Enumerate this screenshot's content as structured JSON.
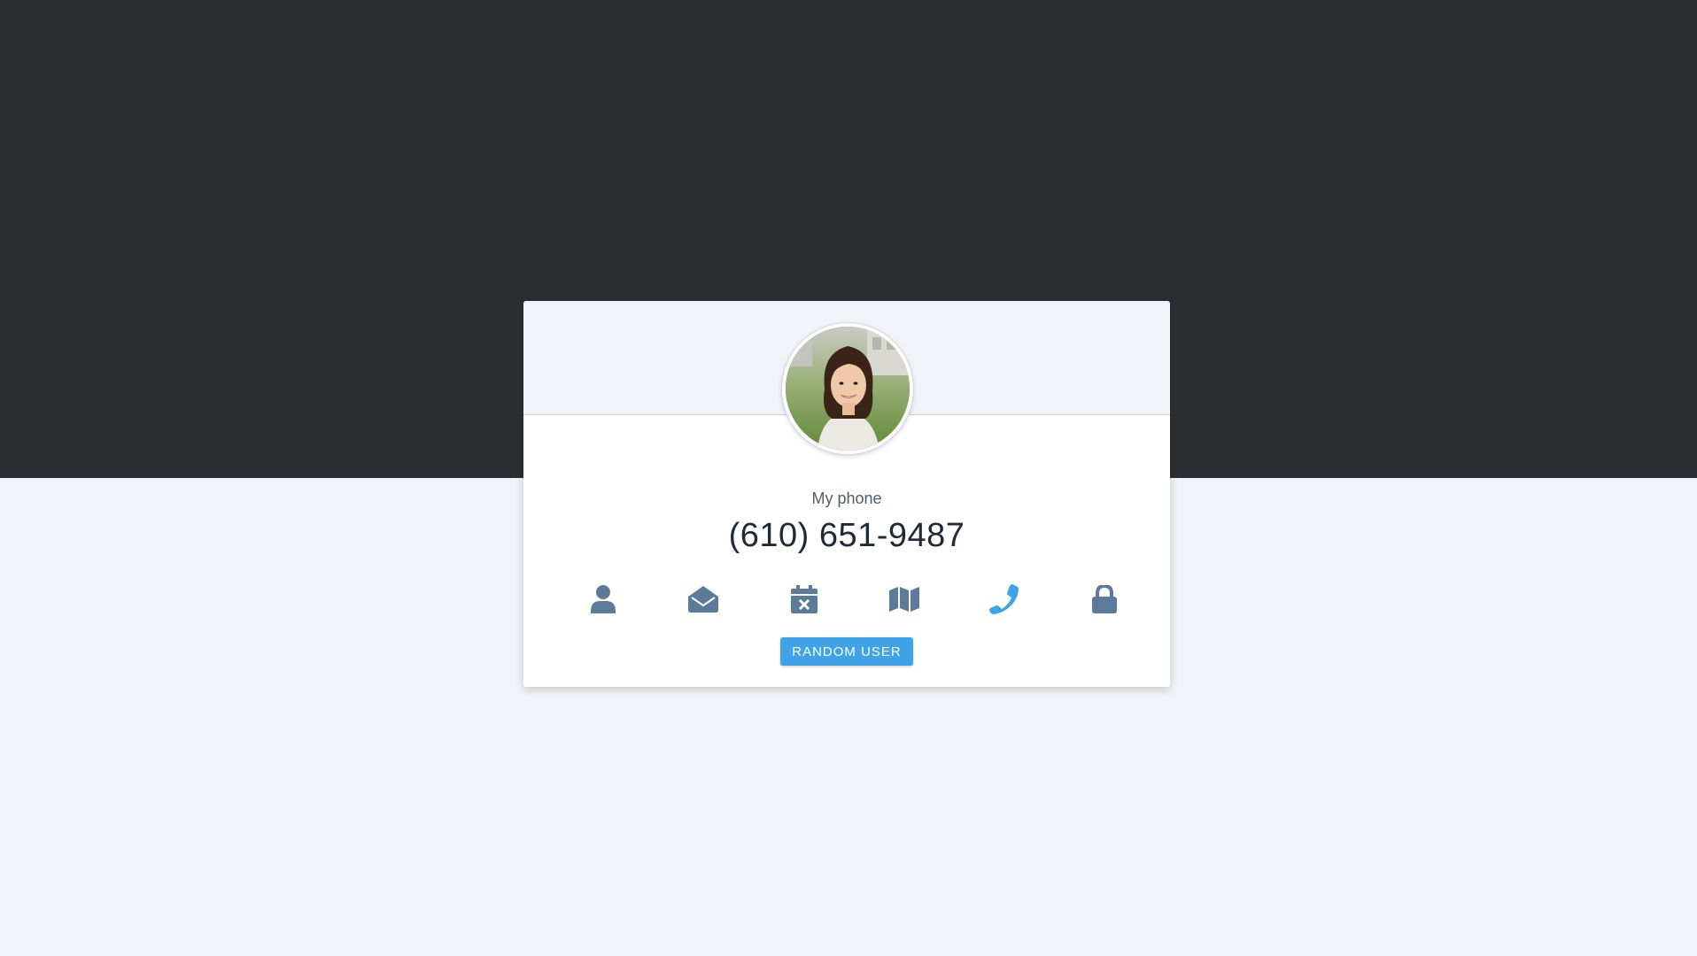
{
  "user": {
    "field_label": "My phone",
    "field_value": "(610) 651-9487"
  },
  "icons": [
    {
      "name": "user-icon",
      "active": false
    },
    {
      "name": "envelope-open-icon",
      "active": false
    },
    {
      "name": "calendar-icon",
      "active": false
    },
    {
      "name": "map-icon",
      "active": false
    },
    {
      "name": "phone-icon",
      "active": true
    },
    {
      "name": "lock-icon",
      "active": false
    }
  ],
  "button": {
    "label": "RANDOM USER"
  },
  "colors": {
    "top_band": "#2d2e32",
    "page_background": "#f0f4f8",
    "icon_default": "#5c7a99",
    "icon_active": "#3fa3e8",
    "button": "#3fa3e8"
  }
}
